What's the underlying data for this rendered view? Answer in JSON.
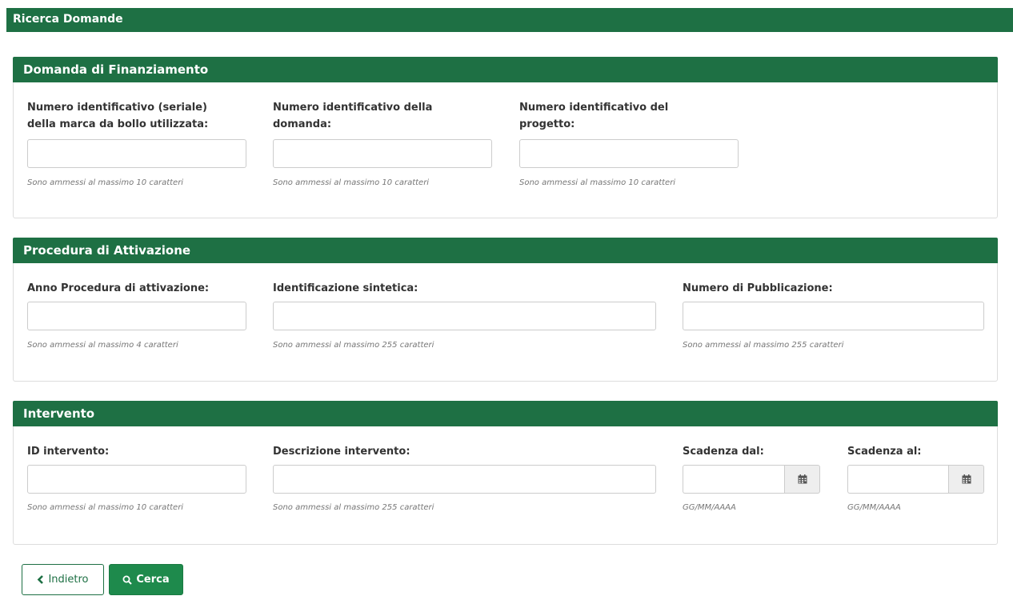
{
  "header": {
    "title": "Ricerca Domande"
  },
  "panels": {
    "domanda": {
      "title": "Domanda di Finanziamento",
      "fields": [
        {
          "label": "Numero identificativo (seriale) della marca da bollo utilizzata:",
          "value": "",
          "help": "Sono ammessi al massimo 10 caratteri"
        },
        {
          "label": "Numero identificativo della domanda:",
          "value": "",
          "help": "Sono ammessi al massimo 10 caratteri"
        },
        {
          "label": "Numero identificativo del progetto:",
          "value": "",
          "help": "Sono ammessi al massimo 10 caratteri"
        }
      ]
    },
    "procedura": {
      "title": "Procedura di Attivazione",
      "fields": [
        {
          "label": "Anno Procedura di attivazione:",
          "value": "",
          "help": "Sono ammessi al massimo 4 caratteri"
        },
        {
          "label": "Identificazione sintetica:",
          "value": "",
          "help": "Sono ammessi al massimo 255 caratteri"
        },
        {
          "label": "Numero di Pubblicazione:",
          "value": "",
          "help": "Sono ammessi al massimo 255 caratteri"
        }
      ]
    },
    "intervento": {
      "title": "Intervento",
      "fields": [
        {
          "label": "ID intervento:",
          "value": "",
          "help": "Sono ammessi al massimo 10 caratteri"
        },
        {
          "label": "Descrizione intervento:",
          "value": "",
          "help": "Sono ammessi al massimo 255 caratteri"
        },
        {
          "label": "Scadenza dal:",
          "value": "",
          "help": "GG/MM/AAAA",
          "icon": "calendar-icon"
        },
        {
          "label": "Scadenza al:",
          "value": "",
          "help": "GG/MM/AAAA",
          "icon": "calendar-icon"
        }
      ]
    }
  },
  "buttons": {
    "back": {
      "label": "Indietro",
      "icon": "chevron-left-icon"
    },
    "search": {
      "label": "Cerca",
      "icon": "search-icon"
    }
  },
  "colors": {
    "header_green": "#1e7044",
    "button_green": "#1e8a4c",
    "border": "#cccccc",
    "help_text": "#777777"
  }
}
